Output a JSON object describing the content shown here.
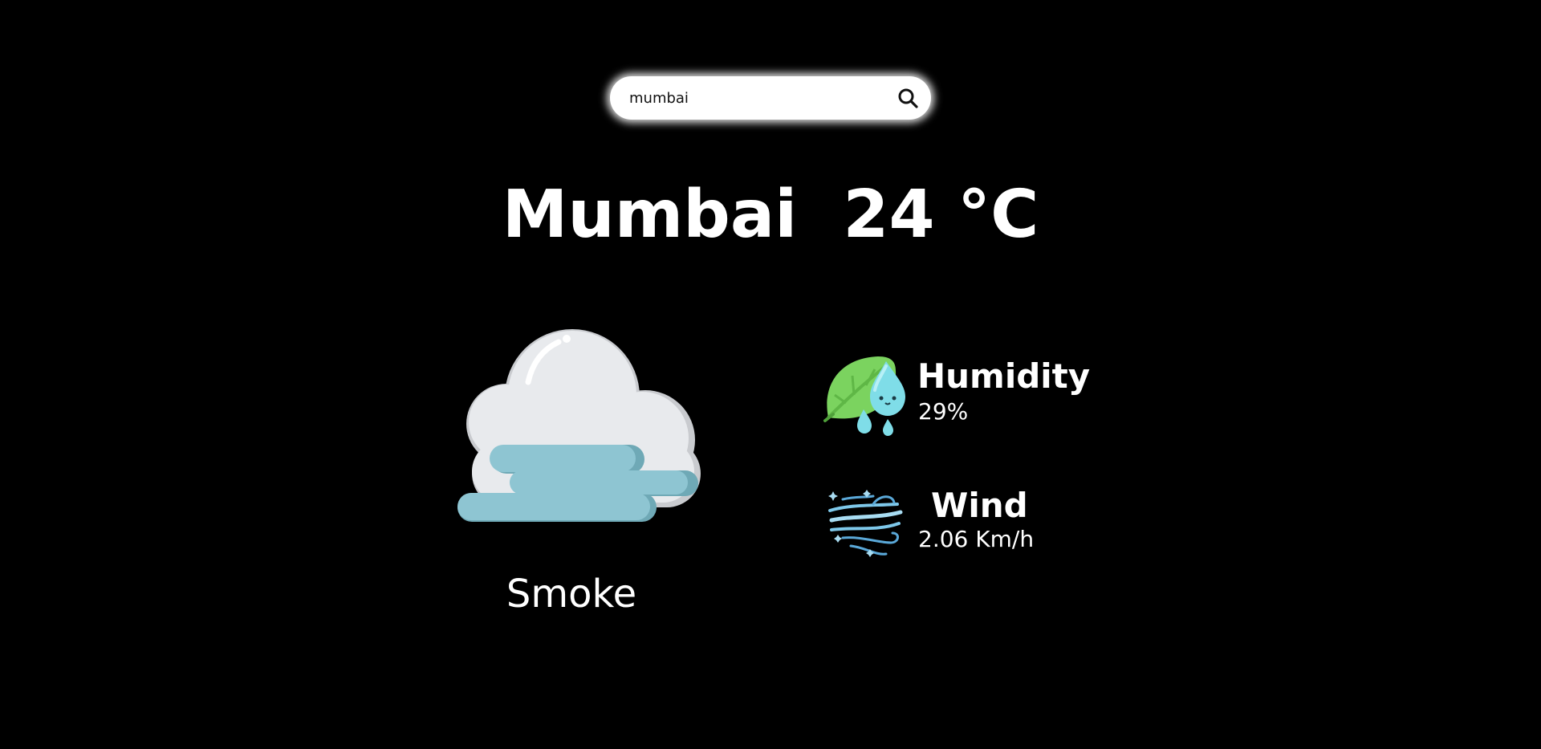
{
  "search": {
    "value": "mumbai",
    "icon": "search-icon"
  },
  "location": {
    "city": "Mumbai",
    "temperature": "24 °C"
  },
  "weather": {
    "condition": "Smoke",
    "icon": "smoke-cloud-icon"
  },
  "details": {
    "humidity": {
      "label": "Humidity",
      "value": "29%",
      "icon": "humidity-icon"
    },
    "wind": {
      "label": "Wind",
      "value": "2.06 Km/h",
      "icon": "wind-icon"
    }
  },
  "colors": {
    "background": "#000000",
    "text": "#ffffff",
    "search_bg": "#ffffff",
    "cloud": "#e8eaed",
    "smoke": "#8ec5d2",
    "leaf": "#7bd35f",
    "drop": "#7fdde8",
    "wind": "#5aa8d8"
  }
}
